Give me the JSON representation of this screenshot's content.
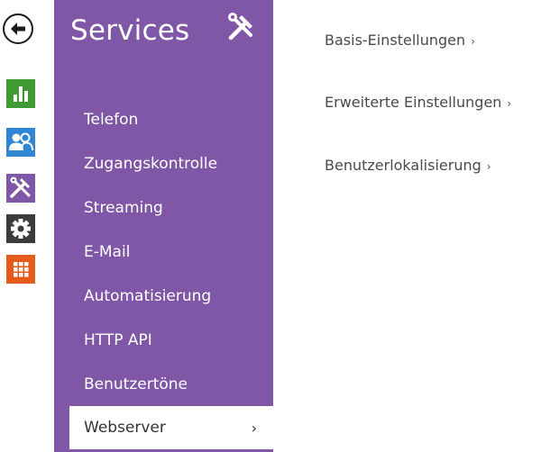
{
  "colors": {
    "panel_purple": "#7f57a6",
    "status_green": "#3f9a33",
    "users_blue": "#2f86d4",
    "services_purple": "#7f57a6",
    "settings_dark": "#3c3c3c",
    "apps_orange": "#e55b1c",
    "active_item_bg": "#ffffff"
  },
  "nav_rail": {
    "back_icon": "arrow-left-circle-icon",
    "items": [
      {
        "icon": "bar-chart-icon",
        "color": "#3f9a33"
      },
      {
        "icon": "users-icon",
        "color": "#2f86d4"
      },
      {
        "icon": "tools-icon",
        "color": "#7f57a6"
      },
      {
        "icon": "gear-icon",
        "color": "#3c3c3c"
      },
      {
        "icon": "grid-icon",
        "color": "#e55b1c"
      }
    ]
  },
  "panel": {
    "title": "Services",
    "title_icon": "hammer-wrench-icon",
    "menu": [
      {
        "label": "Telefon"
      },
      {
        "label": "Zugangskontrolle"
      },
      {
        "label": "Streaming"
      },
      {
        "label": "E-Mail"
      },
      {
        "label": "Automatisierung"
      },
      {
        "label": "HTTP API"
      },
      {
        "label": "Benutzertöne"
      },
      {
        "label": "Webserver",
        "active": true,
        "chevron": "›"
      }
    ]
  },
  "content": {
    "links": [
      {
        "label": "Basis-Einstellungen",
        "chevron": "›"
      },
      {
        "label": "Erweiterte Einstellungen",
        "chevron": "›"
      },
      {
        "label": "Benutzerlokalisierung",
        "chevron": "›"
      }
    ]
  }
}
